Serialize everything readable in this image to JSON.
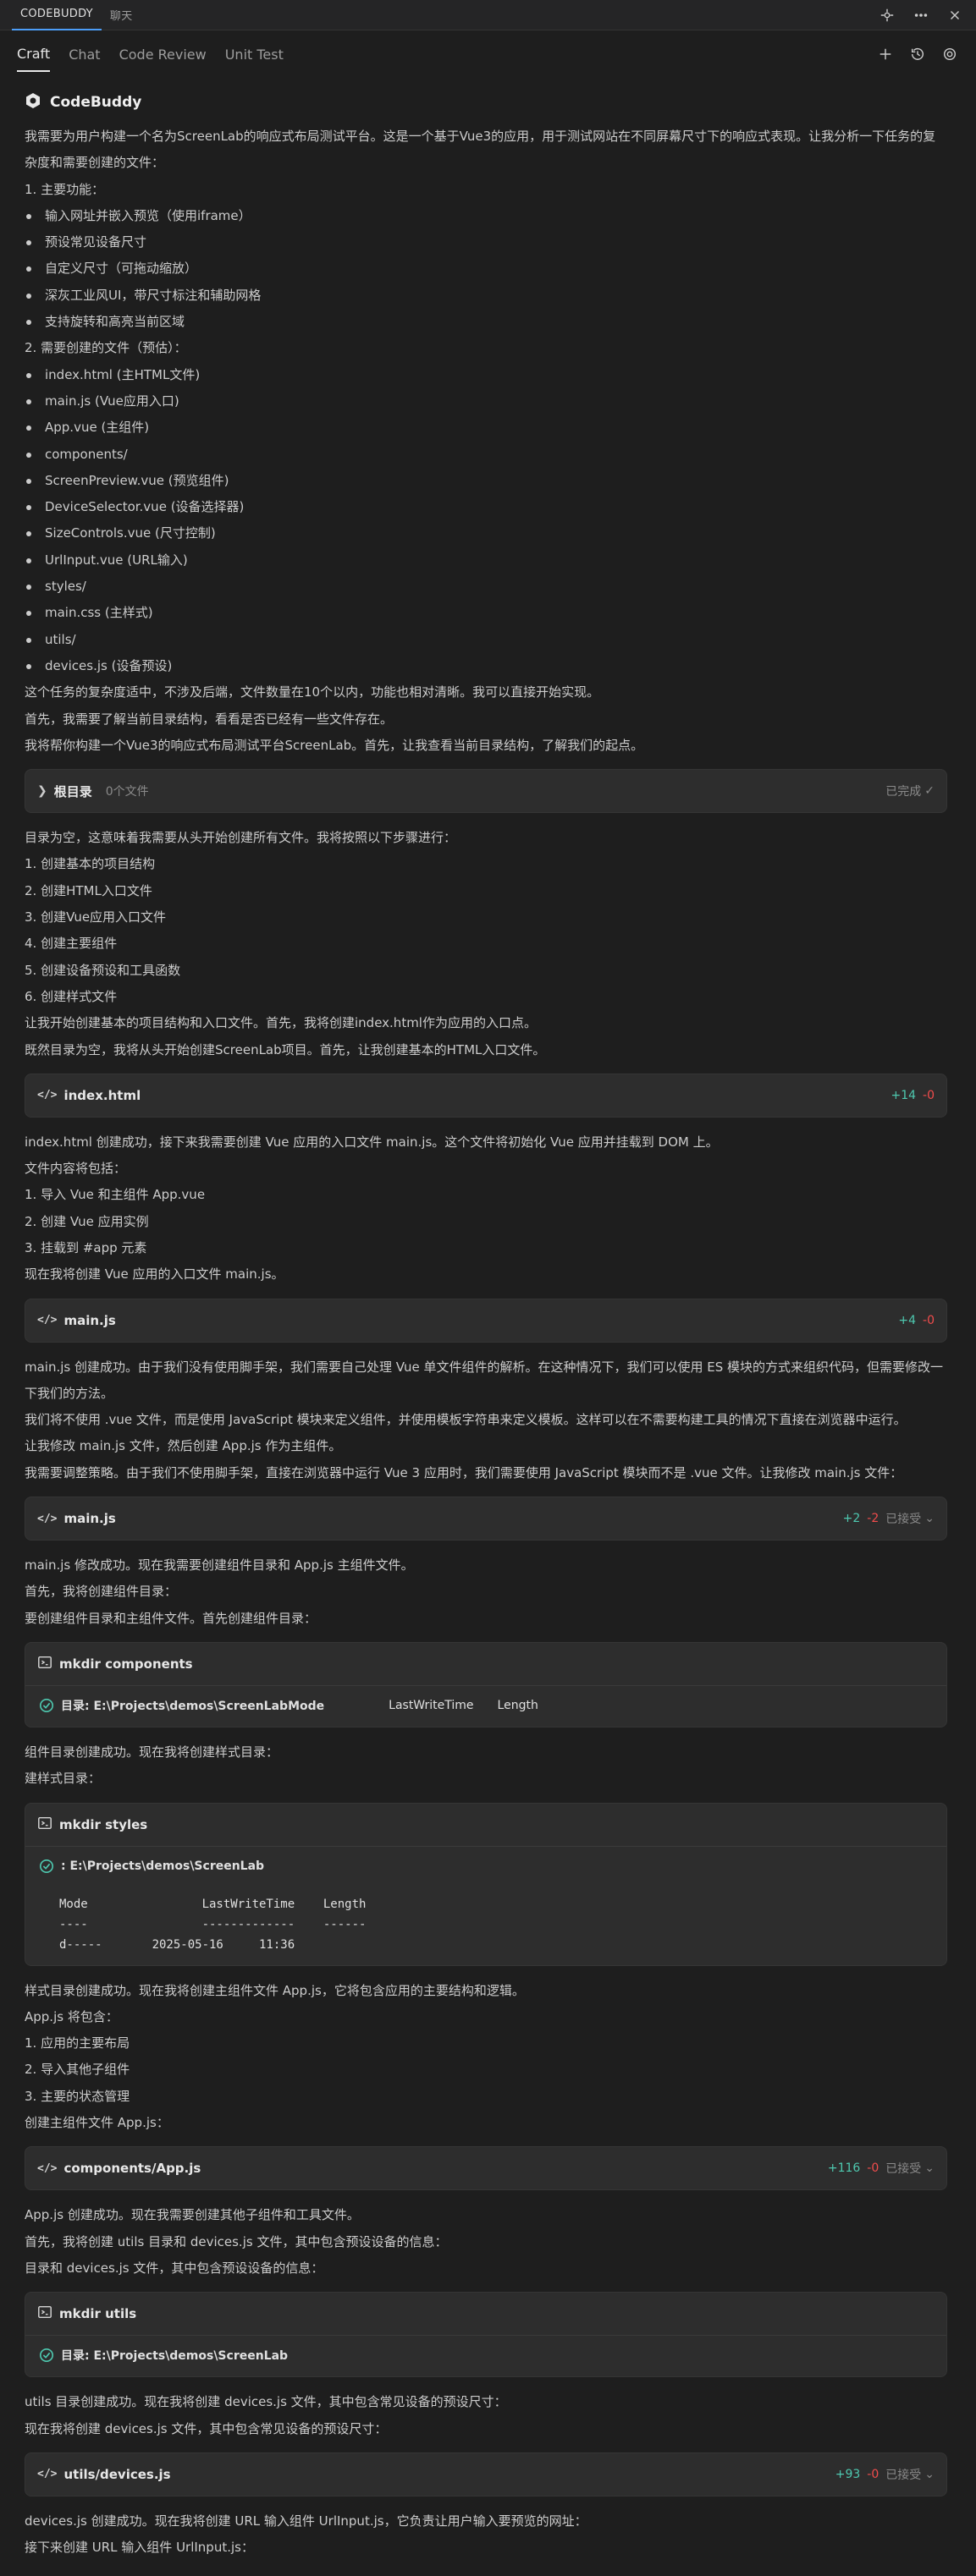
{
  "topbar": {
    "tabs": [
      "CODEBUDDY",
      "聊天"
    ],
    "icons": [
      "extension-icon",
      "more-icon",
      "close-icon"
    ]
  },
  "subbar": {
    "tabs": [
      "Craft",
      "Chat",
      "Code Review",
      "Unit Test"
    ],
    "icons": [
      "plus-icon",
      "history-icon",
      "settings-icon"
    ]
  },
  "brand": {
    "name": "CodeBuddy"
  },
  "blocks": {
    "intro_lines": [
      "我需要为用户构建一个名为ScreenLab的响应式布局测试平台。这是一个基于Vue3的应用，用于测试网站在不同屏幕尺寸下的响应式表现。让我分析一下任务的复杂度和需要创建的文件：",
      "1. 主要功能：",
      "输入网址并嵌入预览（使用iframe）",
      "预设常见设备尺寸",
      "自定义尺寸（可拖动缩放）",
      "深灰工业风UI，带尺寸标注和辅助网格",
      "支持旋转和高亮当前区域",
      "2. 需要创建的文件（预估）：",
      "index.html (主HTML文件)",
      "main.js (Vue应用入口)",
      "App.vue (主组件)",
      "components/",
      "ScreenPreview.vue (预览组件)",
      "DeviceSelector.vue (设备选择器)",
      "SizeControls.vue (尺寸控制)",
      "UrlInput.vue (URL输入)",
      "styles/",
      "main.css (主样式)",
      "utils/",
      "devices.js (设备预设)",
      "这个任务的复杂度适中，不涉及后端，文件数量在10个以内，功能也相对清晰。我可以直接开始实现。",
      "首先，我需要了解当前目录结构，看看是否已经有一些文件存在。",
      "我将帮你构建一个Vue3的响应式布局测试平台ScreenLab。首先，让我查看当前目录结构，了解我们的起点。"
    ],
    "card_root": {
      "name": "根目录",
      "meta": "0个文件",
      "status": "已完成"
    },
    "after_root_lines": [
      "目录为空，这意味着我需要从头开始创建所有文件。我将按照以下步骤进行：",
      "1. 创建基本的项目结构",
      "2. 创建HTML入口文件",
      "3. 创建Vue应用入口文件",
      "4. 创建主要组件",
      "5. 创建设备预设和工具函数",
      "6. 创建样式文件",
      "让我开始创建基本的项目结构和入口文件。首先，我将创建index.html作为应用的入口点。",
      "既然目录为空，我将从头开始创建ScreenLab项目。首先，让我创建基本的HTML入口文件。"
    ],
    "card_index": {
      "name": "index.html",
      "add": "+14",
      "del": "-0"
    },
    "after_index_lines": [
      "index.html 创建成功，接下来我需要创建 Vue 应用的入口文件 main.js。这个文件将初始化 Vue 应用并挂载到 DOM 上。",
      "文件内容将包括：",
      "1. 导入 Vue 和主组件 App.vue",
      "2. 创建 Vue 应用实例",
      "3. 挂载到 #app 元素",
      "现在我将创建 Vue 应用的入口文件 main.js。"
    ],
    "card_main1": {
      "name": "main.js",
      "add": "+4",
      "del": "-0"
    },
    "after_main1_lines": [
      "main.js 创建成功。由于我们没有使用脚手架，我们需要自己处理 Vue 单文件组件的解析。在这种情况下，我们可以使用 ES 模块的方式来组织代码，但需要修改一下我们的方法。",
      "我们将不使用 .vue 文件，而是使用 JavaScript 模块来定义组件，并使用模板字符串来定义模板。这样可以在不需要构建工具的情况下直接在浏览器中运行。",
      "让我修改 main.js 文件，然后创建 App.js 作为主组件。",
      "我需要调整策略。由于我们不使用脚手架，直接在浏览器中运行 Vue 3 应用时，我们需要使用 JavaScript 模块而不是 .vue 文件。让我修改 main.js 文件："
    ],
    "card_main2": {
      "name": "main.js",
      "add": "+2",
      "del": "-2",
      "status": "已接受"
    },
    "after_main2_lines": [
      "main.js 修改成功。现在我需要创建组件目录和 App.js 主组件文件。",
      "首先，我将创建组件目录：",
      "要创建组件目录和主组件文件。首先创建组件目录："
    ],
    "card_mkdir_components": {
      "name": "mkdir components",
      "result_label": "目录: E:\\Projects\\demos\\ScreenLabMode",
      "result_col2": "LastWriteTime",
      "result_col3": "Length"
    },
    "after_components_lines": [
      "组件目录创建成功。现在我将创建样式目录：",
      "建样式目录："
    ],
    "card_mkdir_styles": {
      "name": "mkdir styles",
      "result_label": ": E:\\Projects\\demos\\ScreenLab",
      "output": "Mode                LastWriteTime    Length\n----                -------------    ------\nd-----       2025-05-16     11:36"
    },
    "after_styles_lines": [
      "样式目录创建成功。现在我将创建主组件文件 App.js，它将包含应用的主要结构和逻辑。",
      "App.js 将包含：",
      "1. 应用的主要布局",
      "2. 导入其他子组件",
      "3. 主要的状态管理",
      "创建主组件文件 App.js："
    ],
    "card_app": {
      "name": "components/App.js",
      "add": "+116",
      "del": "-0",
      "status": "已接受"
    },
    "after_app_lines": [
      "App.js 创建成功。现在我需要创建其他子组件和工具文件。",
      "首先，我将创建 utils 目录和 devices.js 文件，其中包含预设设备的信息：",
      "目录和 devices.js 文件，其中包含预设设备的信息："
    ],
    "card_mkdir_utils": {
      "name": "mkdir utils",
      "result_label": "目录: E:\\Projects\\demos\\ScreenLab"
    },
    "after_utils_lines": [
      "utils 目录创建成功。现在我将创建 devices.js 文件，其中包含常见设备的预设尺寸：",
      "现在我将创建 devices.js 文件，其中包含常见设备的预设尺寸："
    ],
    "card_devices": {
      "name": "utils/devices.js",
      "add": "+93",
      "del": "-0",
      "status": "已接受"
    },
    "after_devices_lines": [
      "devices.js 创建成功。现在我将创建 URL 输入组件 UrlInput.js，它负责让用户输入要预览的网址：",
      "接下来创建 URL 输入组件 UrlInput.js："
    ]
  }
}
